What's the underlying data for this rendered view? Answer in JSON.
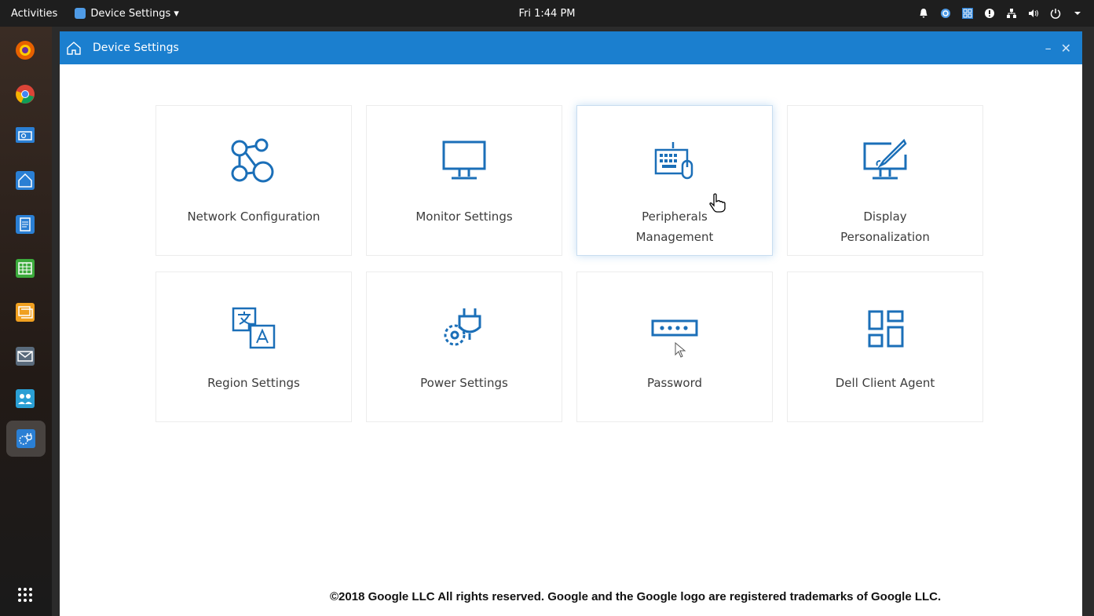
{
  "topbar": {
    "activities": "Activities",
    "app_menu": "Device Settings ▾",
    "clock": "Fri 1:44 PM",
    "tray_icons": [
      "bell-icon",
      "app-indicator-icon",
      "grid-icon",
      "notification-icon",
      "network-icon",
      "volume-icon",
      "power-icon"
    ]
  },
  "dock": {
    "items": [
      "firefox-icon",
      "chrome-icon",
      "file-search-icon",
      "home-icon",
      "document-icon",
      "spreadsheet-icon",
      "presentation-icon",
      "mail-icon",
      "users-icon",
      "device-settings-icon"
    ],
    "apps_grid": "apps-grid-icon"
  },
  "window": {
    "title": "Device Settings",
    "minimize": "–",
    "close": "✕",
    "accent": "#1b7fcf"
  },
  "tiles": [
    {
      "label": "Network Configuration",
      "icon": "network-icon"
    },
    {
      "label": "Monitor Settings",
      "icon": "monitor-icon"
    },
    {
      "label": "Peripherals Management",
      "icon": "keyboard-mouse-icon"
    },
    {
      "label": "Display Personalization",
      "icon": "display-brush-icon"
    },
    {
      "label": "Region Settings",
      "icon": "language-icon"
    },
    {
      "label": "Power Settings",
      "icon": "power-plug-gear-icon"
    },
    {
      "label": "Password",
      "icon": "password-icon"
    },
    {
      "label": "Dell Client Agent",
      "icon": "dashboard-icon"
    }
  ],
  "footer": "©2018 Google LLC All rights reserved. Google and the Google logo are registered trademarks of Google LLC."
}
